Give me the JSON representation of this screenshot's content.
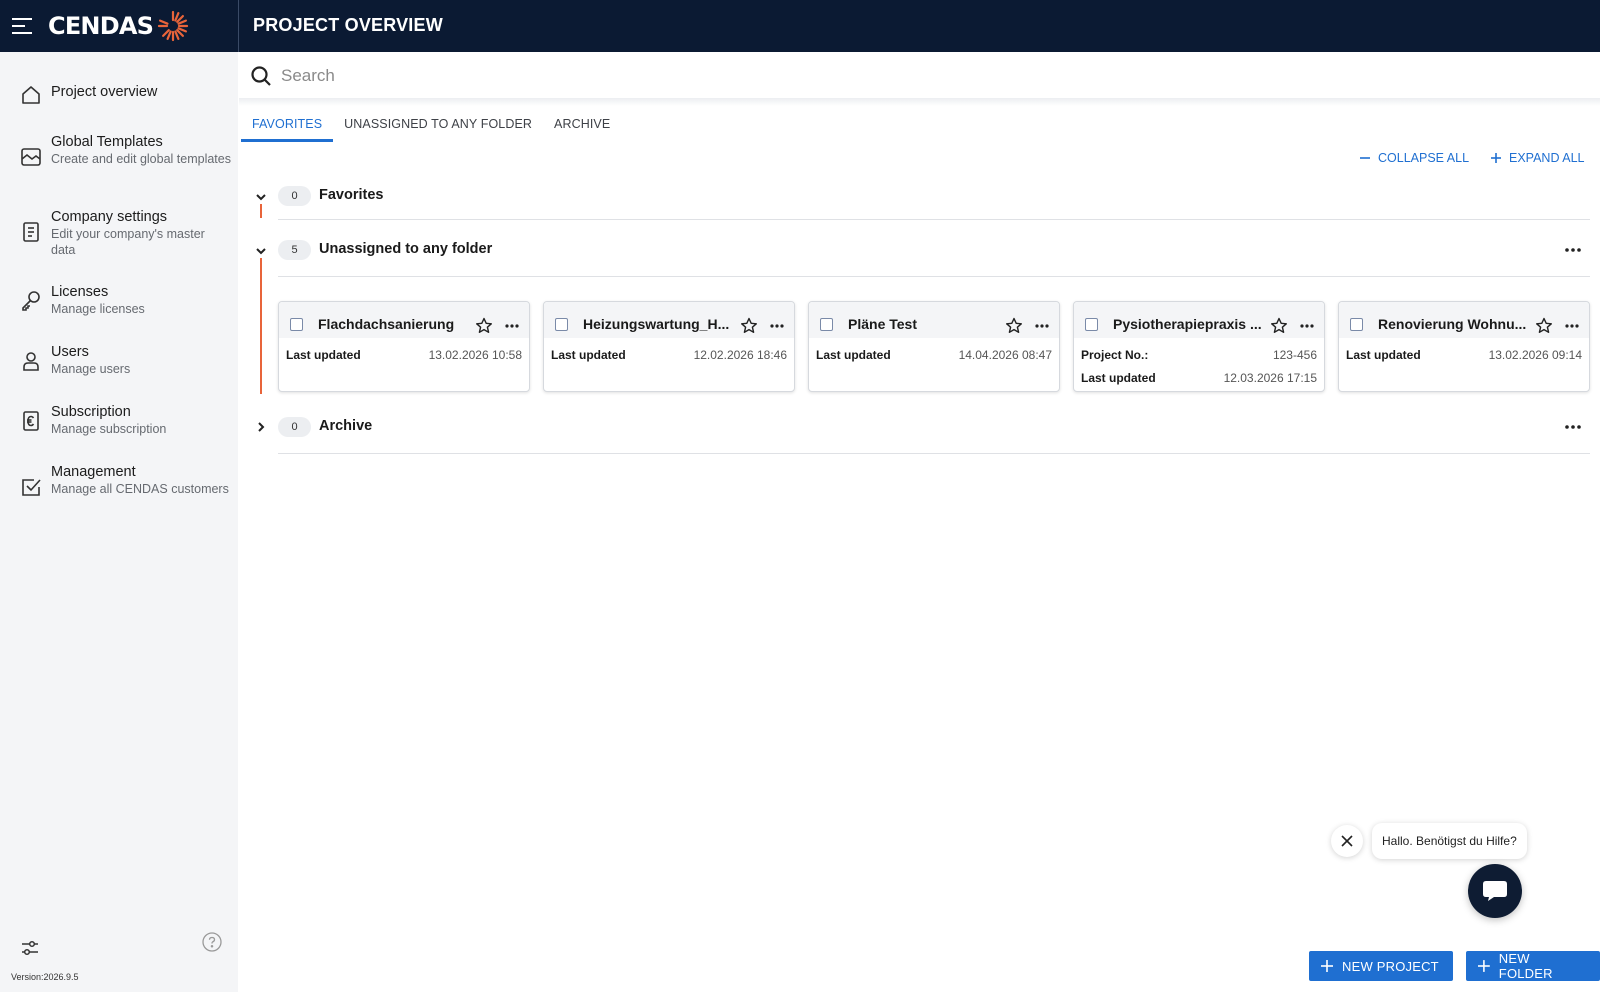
{
  "header": {
    "logo_text": "CENDAS",
    "page_title": "PROJECT OVERVIEW",
    "brand_color": "#0b1a33",
    "accent_color": "#e8643a"
  },
  "sidebar": {
    "items": [
      {
        "label": "Project overview",
        "sub": "",
        "icon": "home-icon"
      },
      {
        "label": "Global Templates",
        "sub": "Create and edit global templates",
        "icon": "template-icon"
      },
      {
        "label": "Company settings",
        "sub": "Edit your company's master data",
        "icon": "document-icon"
      },
      {
        "label": "Licenses",
        "sub": "Manage licenses",
        "icon": "key-icon"
      },
      {
        "label": "Users",
        "sub": "Manage users",
        "icon": "user-icon"
      },
      {
        "label": "Subscription",
        "sub": "Manage subscription",
        "icon": "euro-document-icon"
      },
      {
        "label": "Management",
        "sub": "Manage all CENDAS customers",
        "icon": "checkmark-icon"
      }
    ],
    "version": "Version:2026.9.5"
  },
  "search": {
    "placeholder": "Search",
    "value": ""
  },
  "tabs": [
    {
      "label": "FAVORITES",
      "active": true
    },
    {
      "label": "UNASSIGNED TO ANY FOLDER",
      "active": false
    },
    {
      "label": "ARCHIVE",
      "active": false
    }
  ],
  "actions": {
    "collapse_all": "COLLAPSE ALL",
    "expand_all": "EXPAND ALL"
  },
  "sections": {
    "favorites": {
      "count": "0",
      "title": "Favorites"
    },
    "unassigned": {
      "count": "5",
      "title": "Unassigned to any folder"
    },
    "archive": {
      "count": "0",
      "title": "Archive"
    }
  },
  "projects": [
    {
      "title": "Flachdachsanierung",
      "rows": [
        {
          "k": "Last updated",
          "v": "13.02.2026 10:58"
        }
      ]
    },
    {
      "title": "Heizungswartung_H...",
      "rows": [
        {
          "k": "Last updated",
          "v": "12.02.2026 18:46"
        }
      ]
    },
    {
      "title": "Pläne Test",
      "rows": [
        {
          "k": "Last updated",
          "v": "14.04.2026 08:47"
        }
      ]
    },
    {
      "title": "Pysiotherapiepraxis ...",
      "rows": [
        {
          "k": "Project No.:",
          "v": "123-456"
        },
        {
          "k": "Last updated",
          "v": "12.03.2026 17:15"
        }
      ]
    },
    {
      "title": "Renovierung Wohnu...",
      "rows": [
        {
          "k": "Last updated",
          "v": "13.02.2026 09:14"
        }
      ]
    }
  ],
  "chat": {
    "greeting": "Hallo. Benötigst du Hilfe?"
  },
  "buttons": {
    "new_project": "NEW PROJECT",
    "new_folder": "NEW FOLDER",
    "primary_color": "#1f6fd1"
  }
}
